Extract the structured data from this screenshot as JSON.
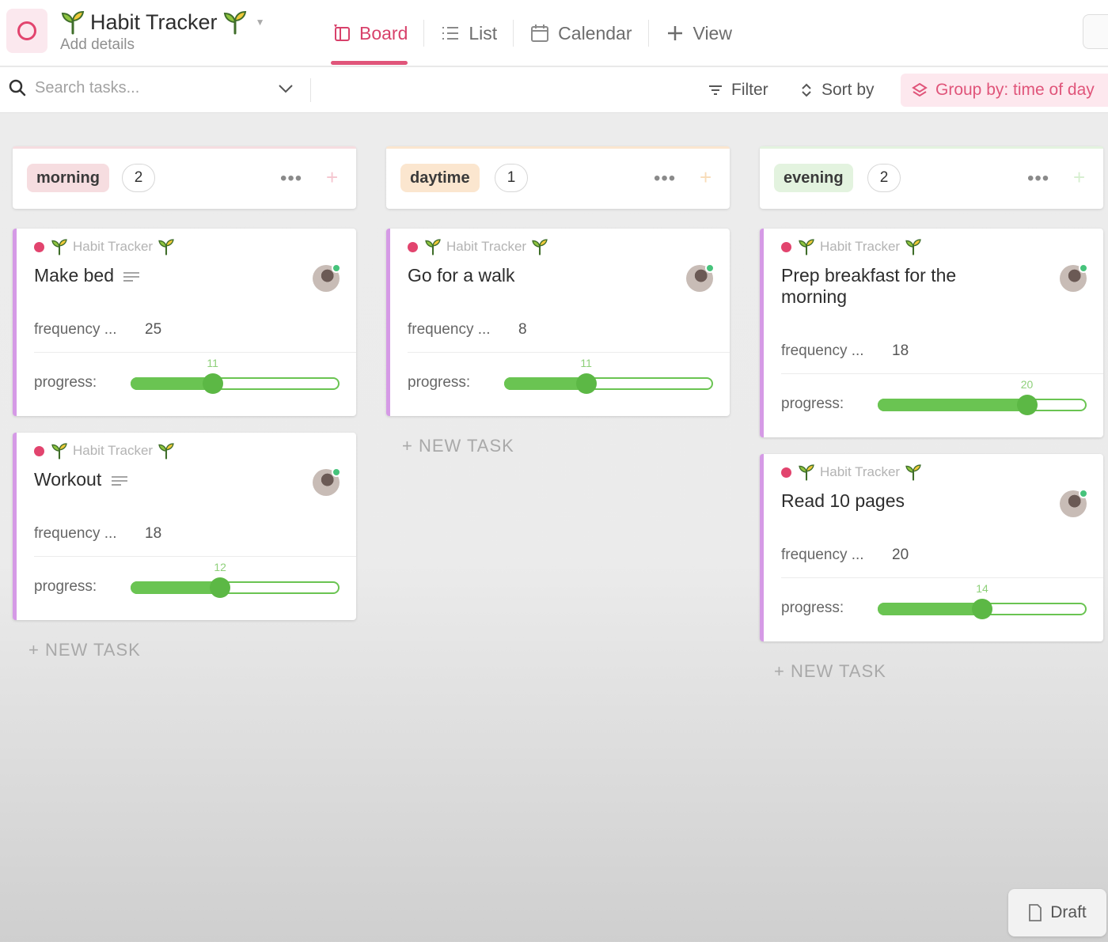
{
  "header": {
    "title": "Habit Tracker",
    "subtitle": "Add details",
    "tabs": [
      {
        "label": "Board",
        "icon": "board-icon",
        "active": true
      },
      {
        "label": "List",
        "icon": "list-icon",
        "active": false
      },
      {
        "label": "Calendar",
        "icon": "calendar-icon",
        "active": false
      },
      {
        "label": "View",
        "icon": "plus-icon",
        "active": false
      }
    ]
  },
  "toolbar": {
    "search_placeholder": "Search tasks...",
    "filter_label": "Filter",
    "sort_label": "Sort by",
    "group_label": "Group by: time of day"
  },
  "colors": {
    "accent": "#e0557a",
    "progress_green": "#6ac452",
    "morning": "#f6dde0",
    "daytime": "#fbe6cf",
    "evening": "#e3f3df",
    "card_stripe": "#d59ae6"
  },
  "columns": [
    {
      "status": "morning",
      "count": "2",
      "new_task_label": "+ NEW TASK",
      "tasks": [
        {
          "location": "Habit Tracker",
          "title": "Make bed",
          "has_description": true,
          "frequency_label": "frequency ...",
          "frequency": "25",
          "progress_label": "progress:",
          "progress": 11,
          "progress_text": "11"
        },
        {
          "location": "Habit Tracker",
          "title": "Workout",
          "has_description": true,
          "frequency_label": "frequency ...",
          "frequency": "18",
          "progress_label": "progress:",
          "progress": 12,
          "progress_text": "12"
        }
      ]
    },
    {
      "status": "daytime",
      "count": "1",
      "new_task_label": "+ NEW TASK",
      "tasks": [
        {
          "location": "Habit Tracker",
          "title": "Go for a walk",
          "has_description": false,
          "frequency_label": "frequency ...",
          "frequency": "8",
          "progress_label": "progress:",
          "progress": 11,
          "progress_text": "11"
        }
      ]
    },
    {
      "status": "evening",
      "count": "2",
      "new_task_label": "+ NEW TASK",
      "tasks": [
        {
          "location": "Habit Tracker",
          "title": "Prep breakfast for the morning",
          "has_description": false,
          "frequency_label": "frequency ...",
          "frequency": "18",
          "progress_label": "progress:",
          "progress": 20,
          "progress_text": "20"
        },
        {
          "location": "Habit Tracker",
          "title": "Read 10 pages",
          "has_description": false,
          "frequency_label": "frequency ...",
          "frequency": "20",
          "progress_label": "progress:",
          "progress": 14,
          "progress_text": "14"
        }
      ]
    }
  ],
  "progress_max": 28,
  "draft_label": "Draft"
}
